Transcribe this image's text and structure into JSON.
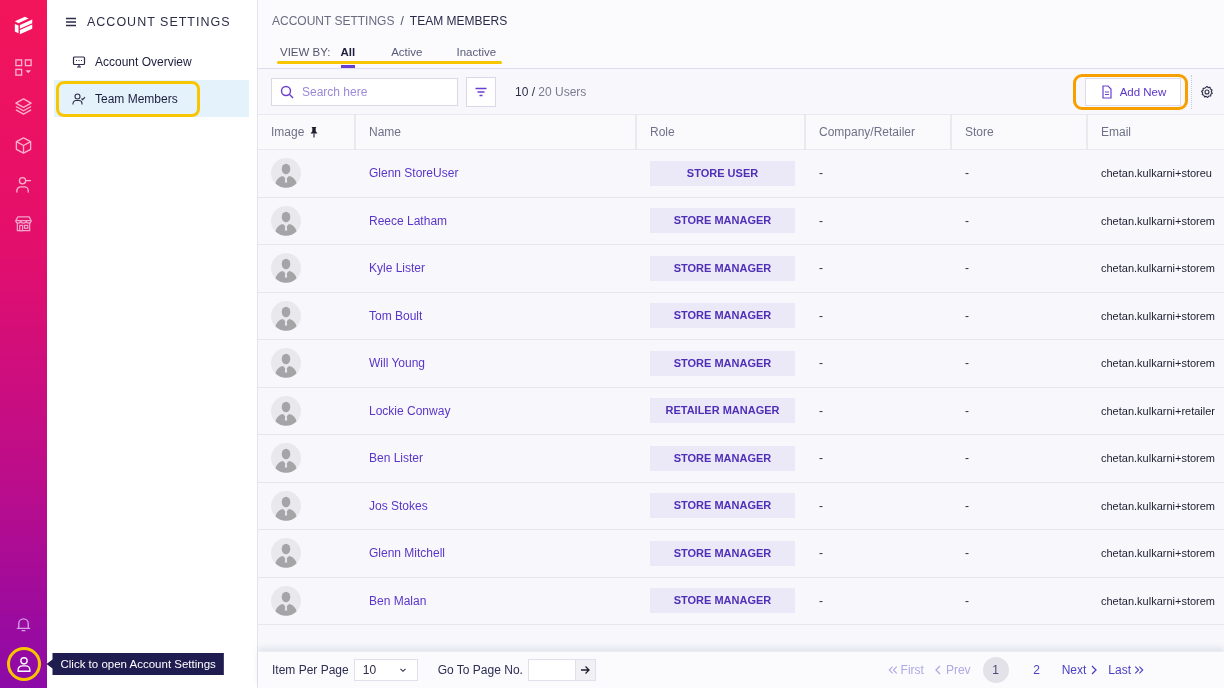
{
  "rail": {
    "account_button": {
      "highlighted": true
    },
    "tooltip": "Click to open Account Settings"
  },
  "sidebar": {
    "title": "ACCOUNT SETTINGS",
    "items": [
      {
        "label": "Account Overview",
        "selected": false,
        "highlighted": false
      },
      {
        "label": "Team Members",
        "selected": true,
        "highlighted": true
      }
    ]
  },
  "breadcrumb": {
    "items": [
      "ACCOUNT SETTINGS",
      "TEAM MEMBERS"
    ],
    "separator": "/"
  },
  "view_by": {
    "label": "VIEW BY:",
    "highlighted": true,
    "tabs": [
      {
        "label": "All",
        "selected": true
      },
      {
        "label": "Active",
        "selected": false
      },
      {
        "label": "Inactive",
        "selected": false
      }
    ]
  },
  "toolbar": {
    "search": {
      "placeholder": "Search here"
    },
    "count": "**10 /** 20 Users",
    "add_button": {
      "label": "Add New",
      "highlighted": true
    }
  },
  "table": {
    "columns": [
      {
        "label": "Image",
        "pinned": true
      },
      {
        "label": "Name",
        "pinned": false
      },
      {
        "label": "Role",
        "pinned": false
      },
      {
        "label": "Company/Retailer",
        "pinned": false
      },
      {
        "label": "Store",
        "pinned": false
      },
      {
        "label": "Email",
        "pinned": false
      }
    ],
    "rows": [
      {
        "name": "Glenn StoreUser",
        "role": "STORE USER",
        "company": "-",
        "store": "-",
        "email": "chetan.kulkarni+storeu"
      },
      {
        "name": "Reece Latham",
        "role": "STORE MANAGER",
        "company": "-",
        "store": "-",
        "email": "chetan.kulkarni+storem"
      },
      {
        "name": "Kyle Lister",
        "role": "STORE MANAGER",
        "company": "-",
        "store": "-",
        "email": "chetan.kulkarni+storem"
      },
      {
        "name": "Tom Boult",
        "role": "STORE MANAGER",
        "company": "-",
        "store": "-",
        "email": "chetan.kulkarni+storem"
      },
      {
        "name": "Will Young",
        "role": "STORE MANAGER",
        "company": "-",
        "store": "-",
        "email": "chetan.kulkarni+storem"
      },
      {
        "name": "Lockie Conway",
        "role": "RETAILER MANAGER",
        "company": "-",
        "store": "-",
        "email": "chetan.kulkarni+retailer"
      },
      {
        "name": "Ben Lister",
        "role": "STORE MANAGER",
        "company": "-",
        "store": "-",
        "email": "chetan.kulkarni+storem"
      },
      {
        "name": "Jos Stokes",
        "role": "STORE MANAGER",
        "company": "-",
        "store": "-",
        "email": "chetan.kulkarni+storem"
      },
      {
        "name": "Glenn Mitchell",
        "role": "STORE MANAGER",
        "company": "-",
        "store": "-",
        "email": "chetan.kulkarni+storem"
      },
      {
        "name": "Ben Malan",
        "role": "STORE MANAGER",
        "company": "-",
        "store": "-",
        "email": "chetan.kulkarni+storem"
      }
    ]
  },
  "footer": {
    "items_per_page": {
      "label": "Item Per Page",
      "value": "10"
    },
    "go_to_page": {
      "label": "Go To Page No."
    },
    "pagination": {
      "first": {
        "label": "First",
        "disabled": true
      },
      "prev": {
        "label": "Prev",
        "disabled": true
      },
      "pages": [
        {
          "label": "1",
          "selected": true
        },
        {
          "label": "2",
          "selected": false
        }
      ],
      "next": {
        "label": "Next",
        "disabled": false
      },
      "last": {
        "label": "Last",
        "disabled": false
      }
    }
  }
}
